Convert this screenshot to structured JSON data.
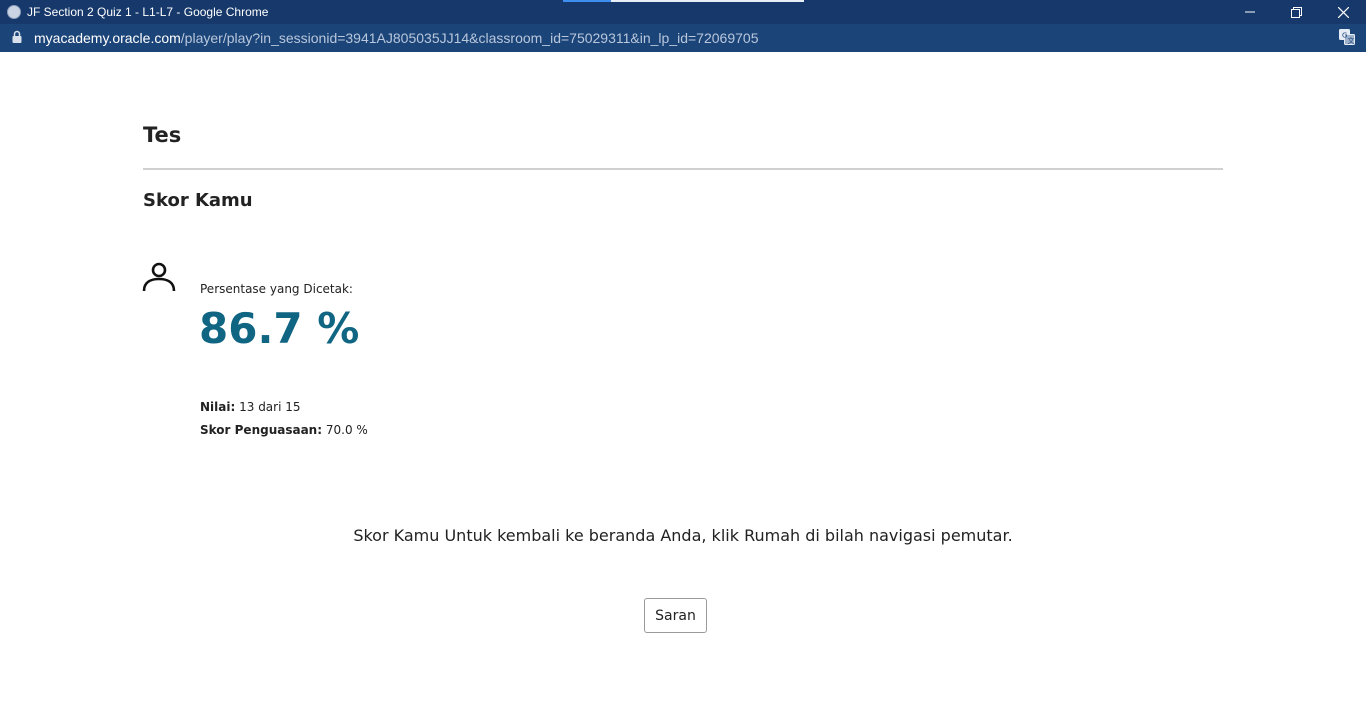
{
  "window": {
    "title": "JF Section 2 Quiz 1 - L1-L7 - Google Chrome",
    "icon": "chrome-globe-icon"
  },
  "addressbar": {
    "domain": "myacademy.oracle.com",
    "path": "/player/play?in_sessionid=3941AJ805035JJ14&classroom_id=75029311&in_lp_id=72069705"
  },
  "content": {
    "page_title": "Tes",
    "section_title": "Skor Kamu",
    "percentage_label": "Persentase yang Dicetak:",
    "percentage_value": "86.7 %",
    "nilai_label": "Nilai:",
    "nilai_value": "13 dari 15",
    "mastery_label": "Skor Penguasaan:",
    "mastery_value": "70.0 %",
    "message": "Skor Kamu Untuk kembali ke beranda Anda, klik Rumah di bilah navigasi pemutar.",
    "feedback_button": "Saran"
  },
  "colors": {
    "titlebar_bg": "#16386a",
    "addressbar_bg": "#1b4478",
    "score_accent": "#0f6582"
  }
}
